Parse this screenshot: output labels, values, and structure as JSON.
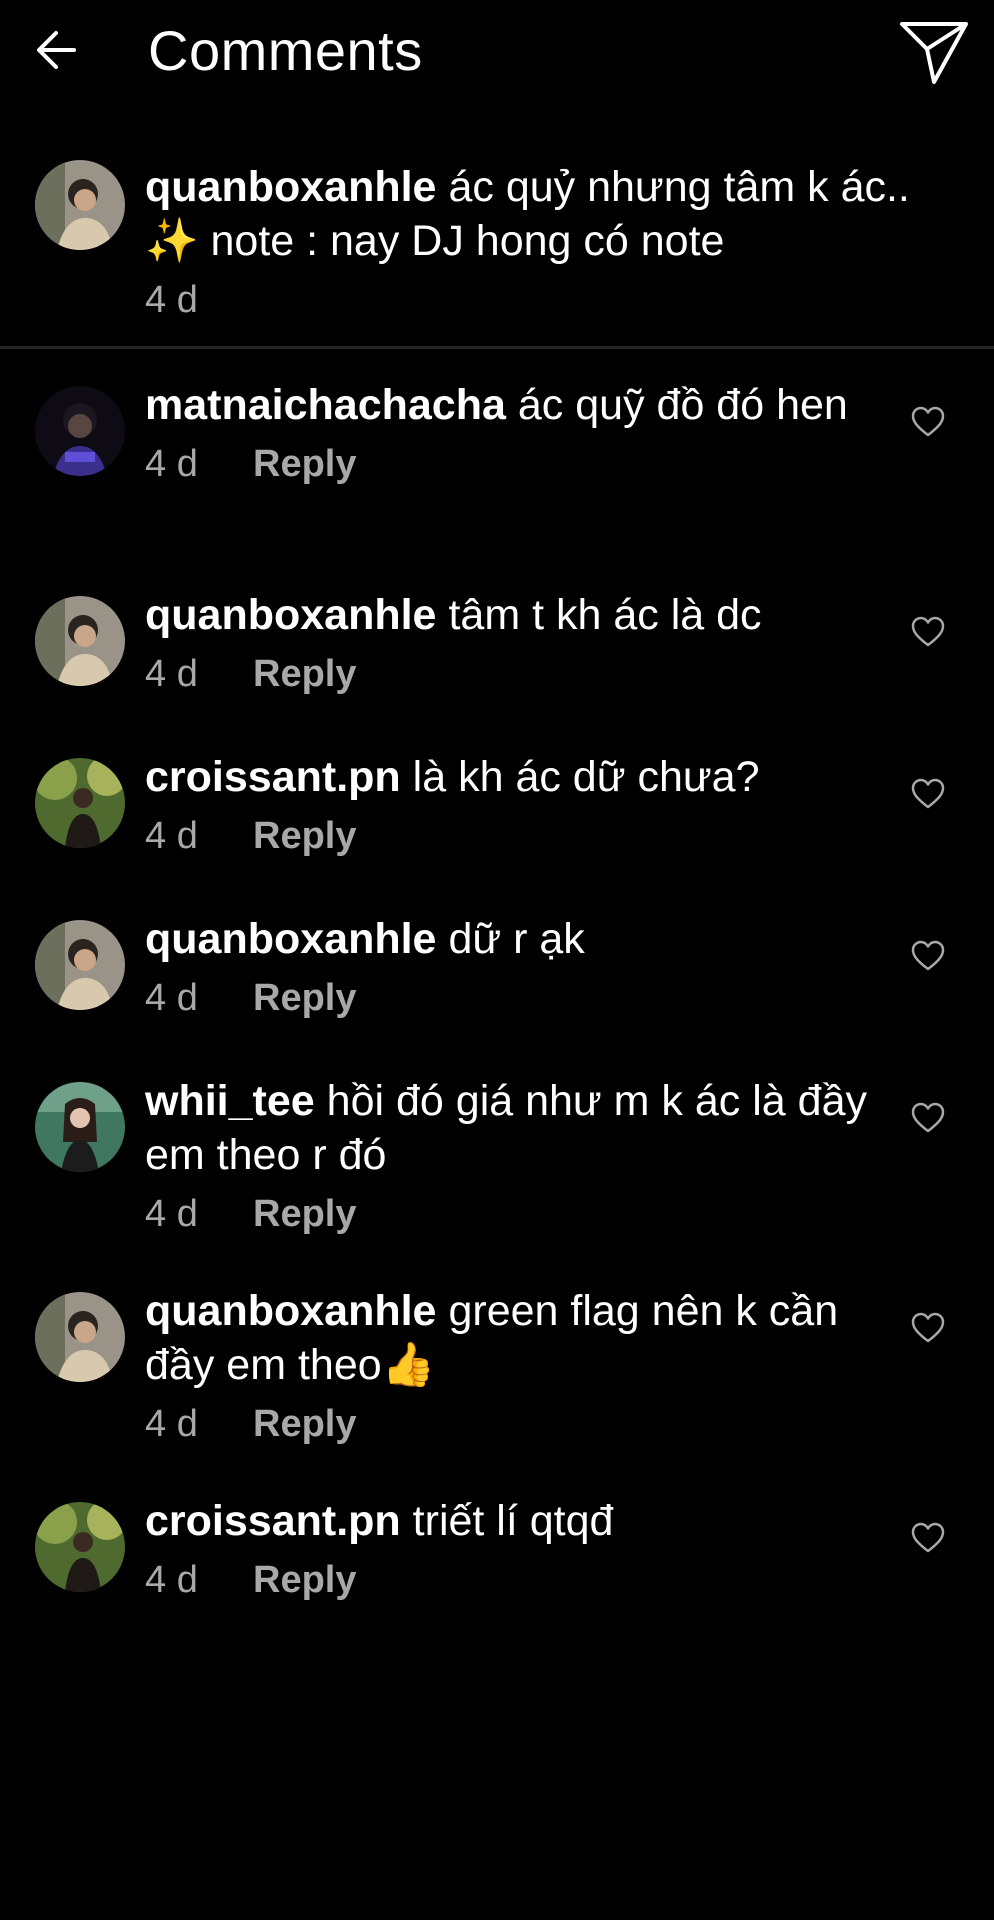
{
  "header": {
    "title": "Comments",
    "back_icon": "arrow-left-icon",
    "send_icon": "paper-plane-icon"
  },
  "caption": {
    "username": "quanboxanhle",
    "text": "ác quỷ nhưng tâm k ác.. ✨ note : nay DJ hong có note",
    "time": "4 d"
  },
  "comments": [
    {
      "username": "matnaichachacha",
      "text": "ác quỹ đồ đó hen",
      "time": "4 d",
      "reply": "Reply",
      "like_icon": "heart-outline-icon"
    },
    {
      "username": "quanboxanhle",
      "text": "tâm t kh ác là dc",
      "time": "4 d",
      "reply": "Reply",
      "like_icon": "heart-outline-icon"
    },
    {
      "username": "croissant.pn",
      "text": "là kh ác dữ chưa?",
      "time": "4 d",
      "reply": "Reply",
      "like_icon": "heart-outline-icon"
    },
    {
      "username": "quanboxanhle",
      "text": "dữ r ạk",
      "time": "4 d",
      "reply": "Reply",
      "like_icon": "heart-outline-icon"
    },
    {
      "username": "whii_tee",
      "text": "hồi đó giá như m k ác là đầy em theo r đó",
      "time": "4 d",
      "reply": "Reply",
      "like_icon": "heart-outline-icon"
    },
    {
      "username": "quanboxanhle",
      "text": "green flag nên k cần đầy em theo👍",
      "time": "4 d",
      "reply": "Reply",
      "like_icon": "heart-outline-icon"
    },
    {
      "username": "croissant.pn",
      "text": "triết lí qtqđ",
      "time": "4 d",
      "reply": "Reply",
      "like_icon": "heart-outline-icon"
    }
  ],
  "colors": {
    "background": "#000000",
    "text": "#ffffff",
    "secondary": "#a8a8a8",
    "divider": "#262626"
  }
}
